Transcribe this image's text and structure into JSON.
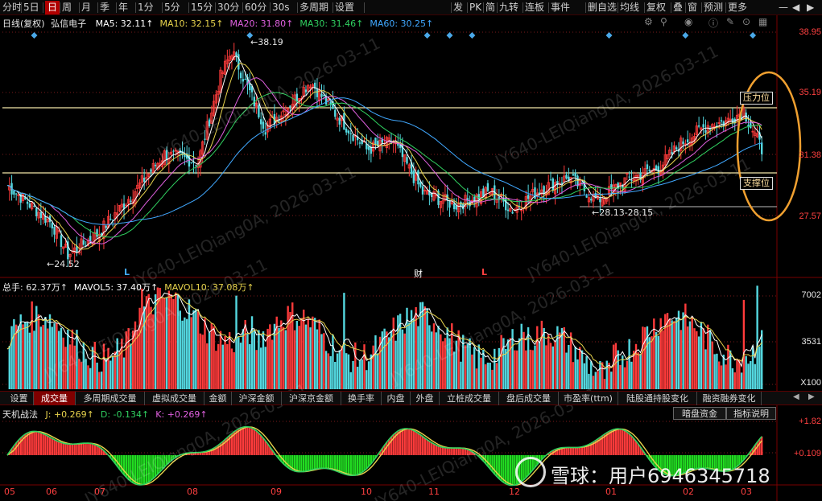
{
  "toolbar": {
    "left_items": [
      "分时",
      "5日",
      "日",
      "周",
      "月",
      "季",
      "年",
      "1分",
      "5分",
      "15分",
      "30分",
      "60分",
      "30s",
      "多周期",
      "设置"
    ],
    "active": "日",
    "right_items": [
      "发",
      "PK",
      "简",
      "九转",
      "连板",
      "事件",
      "删自选",
      "均线",
      "复权",
      "叠",
      "窗",
      "预测",
      "更多"
    ]
  },
  "kline": {
    "title": "日线(复权)",
    "stock_name": "弘信电子",
    "ma": [
      {
        "label": "MA5: 32.11↑",
        "color": "#ffffff"
      },
      {
        "label": "MA10: 32.15↑",
        "color": "#e8d44d"
      },
      {
        "label": "MA20: 31.80↑",
        "color": "#e060e0"
      },
      {
        "label": "MA30: 31.46↑",
        "color": "#30d060"
      },
      {
        "label": "MA60: 30.25↑",
        "color": "#40a8ff"
      }
    ],
    "y_labels": [
      "38.95",
      "35.19",
      "31.38",
      "27.57"
    ],
    "high_marker": "38.19",
    "low_marker": "24.52",
    "range_marker": "28.13-28.15",
    "resistance_label": "压力位",
    "support_label": "支撑位",
    "markers": [
      "L",
      "财",
      "L"
    ]
  },
  "volume": {
    "header": [
      {
        "label": "总手: 62.37万↑",
        "color": "#e8e8e8"
      },
      {
        "label": "MAVOL5: 37.40万↑",
        "color": "#ffffff"
      },
      {
        "label": "MAVOL10: 37.08万↑",
        "color": "#e8d44d"
      }
    ],
    "y_labels": [
      "7002",
      "3531",
      "X100"
    ]
  },
  "tabs": [
    "设置",
    "成交量",
    "多周期成交量",
    "虚拟成交量",
    "金额",
    "沪深金额",
    "沪深京金额",
    "换手率",
    "内盘",
    "外盘",
    "立桩成交量",
    "盘后成交量",
    "市盈率(ttm)",
    "陆股通持股变化",
    "融资融券变化"
  ],
  "active_tab": "成交量",
  "indicator": {
    "name": "天机战法",
    "values": [
      {
        "label": "J: +0.269↑",
        "color": "#e8d44d"
      },
      {
        "label": "D: -0.134↑",
        "color": "#30d060"
      },
      {
        "label": "K: +0.269↑",
        "color": "#e060e0"
      }
    ],
    "buttons": [
      "暗盘资金",
      "指标说明"
    ],
    "y_labels": [
      "+1.82",
      "+0.109"
    ]
  },
  "x_axis": [
    "05",
    "06",
    "07",
    "08",
    "09",
    "10",
    "11",
    "12",
    "01",
    "02",
    "03"
  ],
  "watermark_text": "JY640-LEIQiang0A, 2026-03-11",
  "footer_brand": "雪球：用户6946345718",
  "colors": {
    "up": "#ff3b3b",
    "down": "#54d8e0",
    "accent": "#f0a030"
  }
}
